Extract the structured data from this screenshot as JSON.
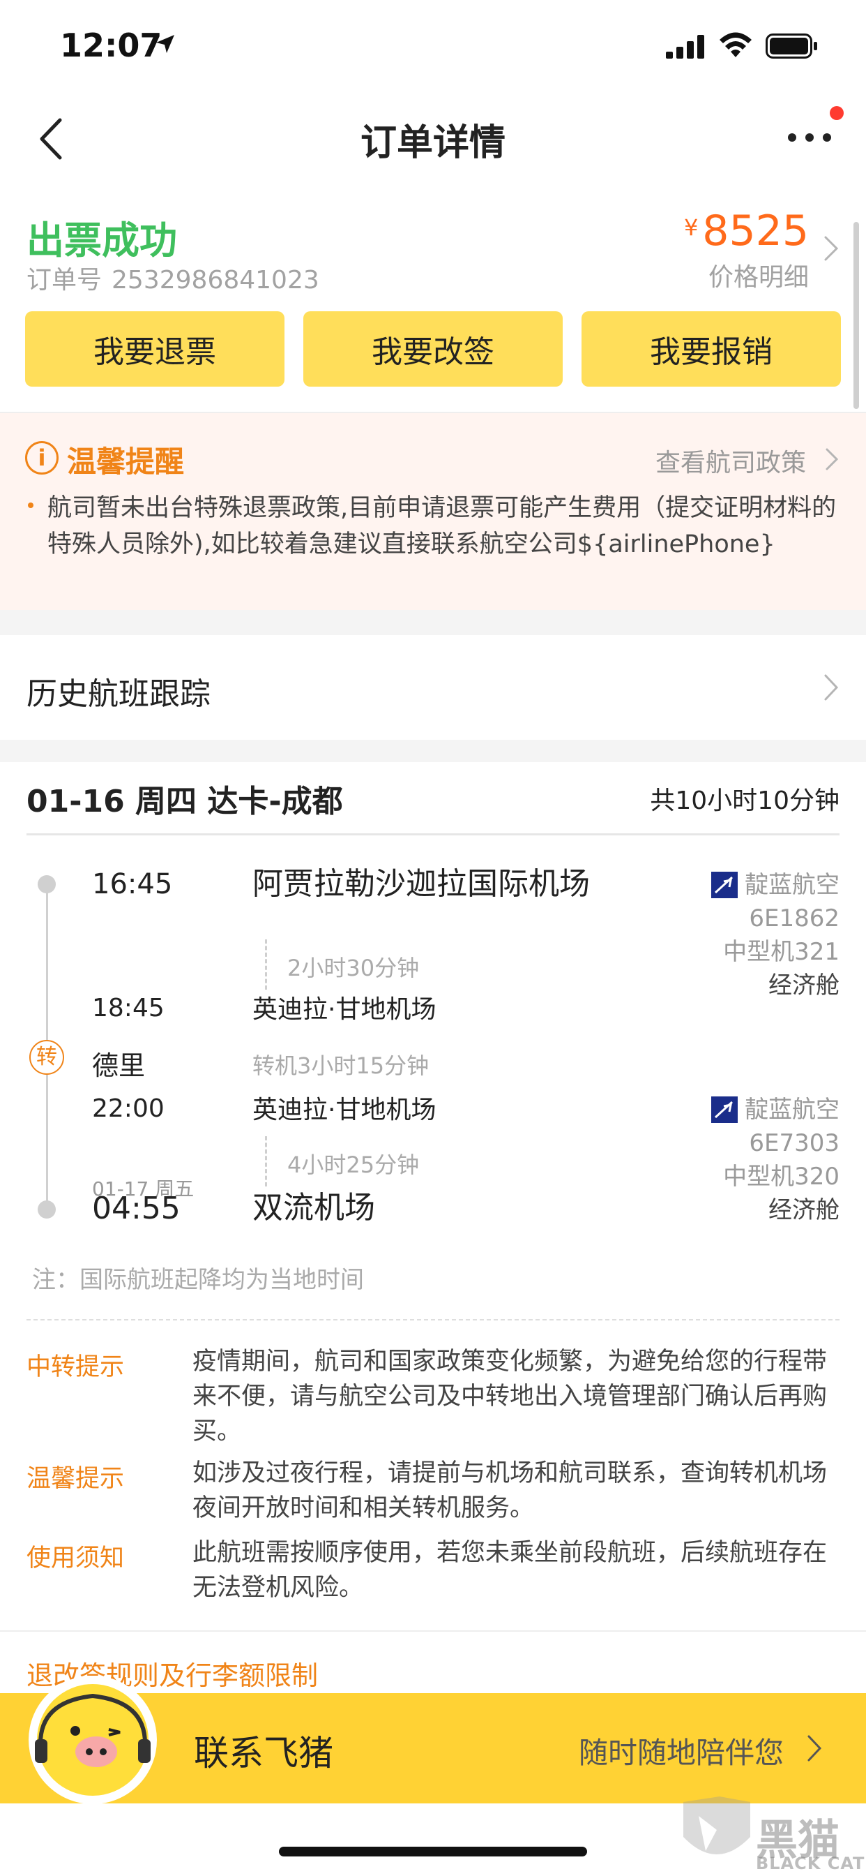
{
  "status_bar": {
    "time": "12:07"
  },
  "nav": {
    "title": "订单详情"
  },
  "order": {
    "status": "出票成功",
    "order_no_label": "订单号",
    "order_no": "2532986841023",
    "currency": "¥",
    "price": "8525",
    "price_detail": "价格明细"
  },
  "actions": [
    {
      "label": "我要退票"
    },
    {
      "label": "我要改签"
    },
    {
      "label": "我要报销"
    }
  ],
  "notice": {
    "title": "温馨提醒",
    "link": "查看航司政策",
    "text": "航司暂未出台特殊退票政策,目前申请退票可能产生费用（提交证明材料的特殊人员除外),如比较着急建议直接联系航空公司${airlinePhone}"
  },
  "history": {
    "label": "历史航班跟踪"
  },
  "flight": {
    "header": "01-16 周四 达卡-成都",
    "total": "共10小时10分钟",
    "seg1": {
      "dep_time": "16:45",
      "dep_airport": "阿贾拉勒沙迦拉国际机场",
      "duration": "2小时30分钟",
      "arr_time": "18:45",
      "arr_airport": "英迪拉·甘地机场",
      "airline": "靛蓝航空",
      "flight_no": "6E1862",
      "aircraft": "中型机321",
      "cabin": "经济舱"
    },
    "transfer": {
      "badge": "转",
      "city": "德里",
      "duration": "转机3小时15分钟"
    },
    "seg2": {
      "dep_time": "22:00",
      "dep_airport": "英迪拉·甘地机场",
      "duration": "4小时25分钟",
      "arr_date": "01-17 周五",
      "arr_time": "04:55",
      "arr_airport": "双流机场",
      "airline": "靛蓝航空",
      "flight_no": "6E7303",
      "aircraft": "中型机320",
      "cabin": "经济舱"
    },
    "note": "注：国际航班起降均为当地时间"
  },
  "tips": [
    {
      "label": "中转提示",
      "text": "疫情期间，航司和国家政策变化频繁，为避免给您的行程带来不便，请与航空公司及中转地出入境管理部门确认后再购买。"
    },
    {
      "label": "温馨提示",
      "text": "如涉及过夜行程，请提前与机场和航司联系，查询转机机场夜间开放时间和相关转机服务。"
    },
    {
      "label": "使用须知",
      "text": "此航班需按顺序使用，若您未乘坐前段航班，后续航班存在无法登机风险。"
    }
  ],
  "rules_link": "退改签规则及行李额限制",
  "bottom": {
    "title": "联系飞猪",
    "slogan": "随时随地陪伴您"
  },
  "watermark": {
    "text": "黑猫",
    "sub": "BLACK CAT"
  },
  "colors": {
    "success": "#3fbf5d",
    "price": "#ff6a1a",
    "accent": "#f08418",
    "button": "#ffde5a",
    "bottom_bar": "#ffd234"
  }
}
